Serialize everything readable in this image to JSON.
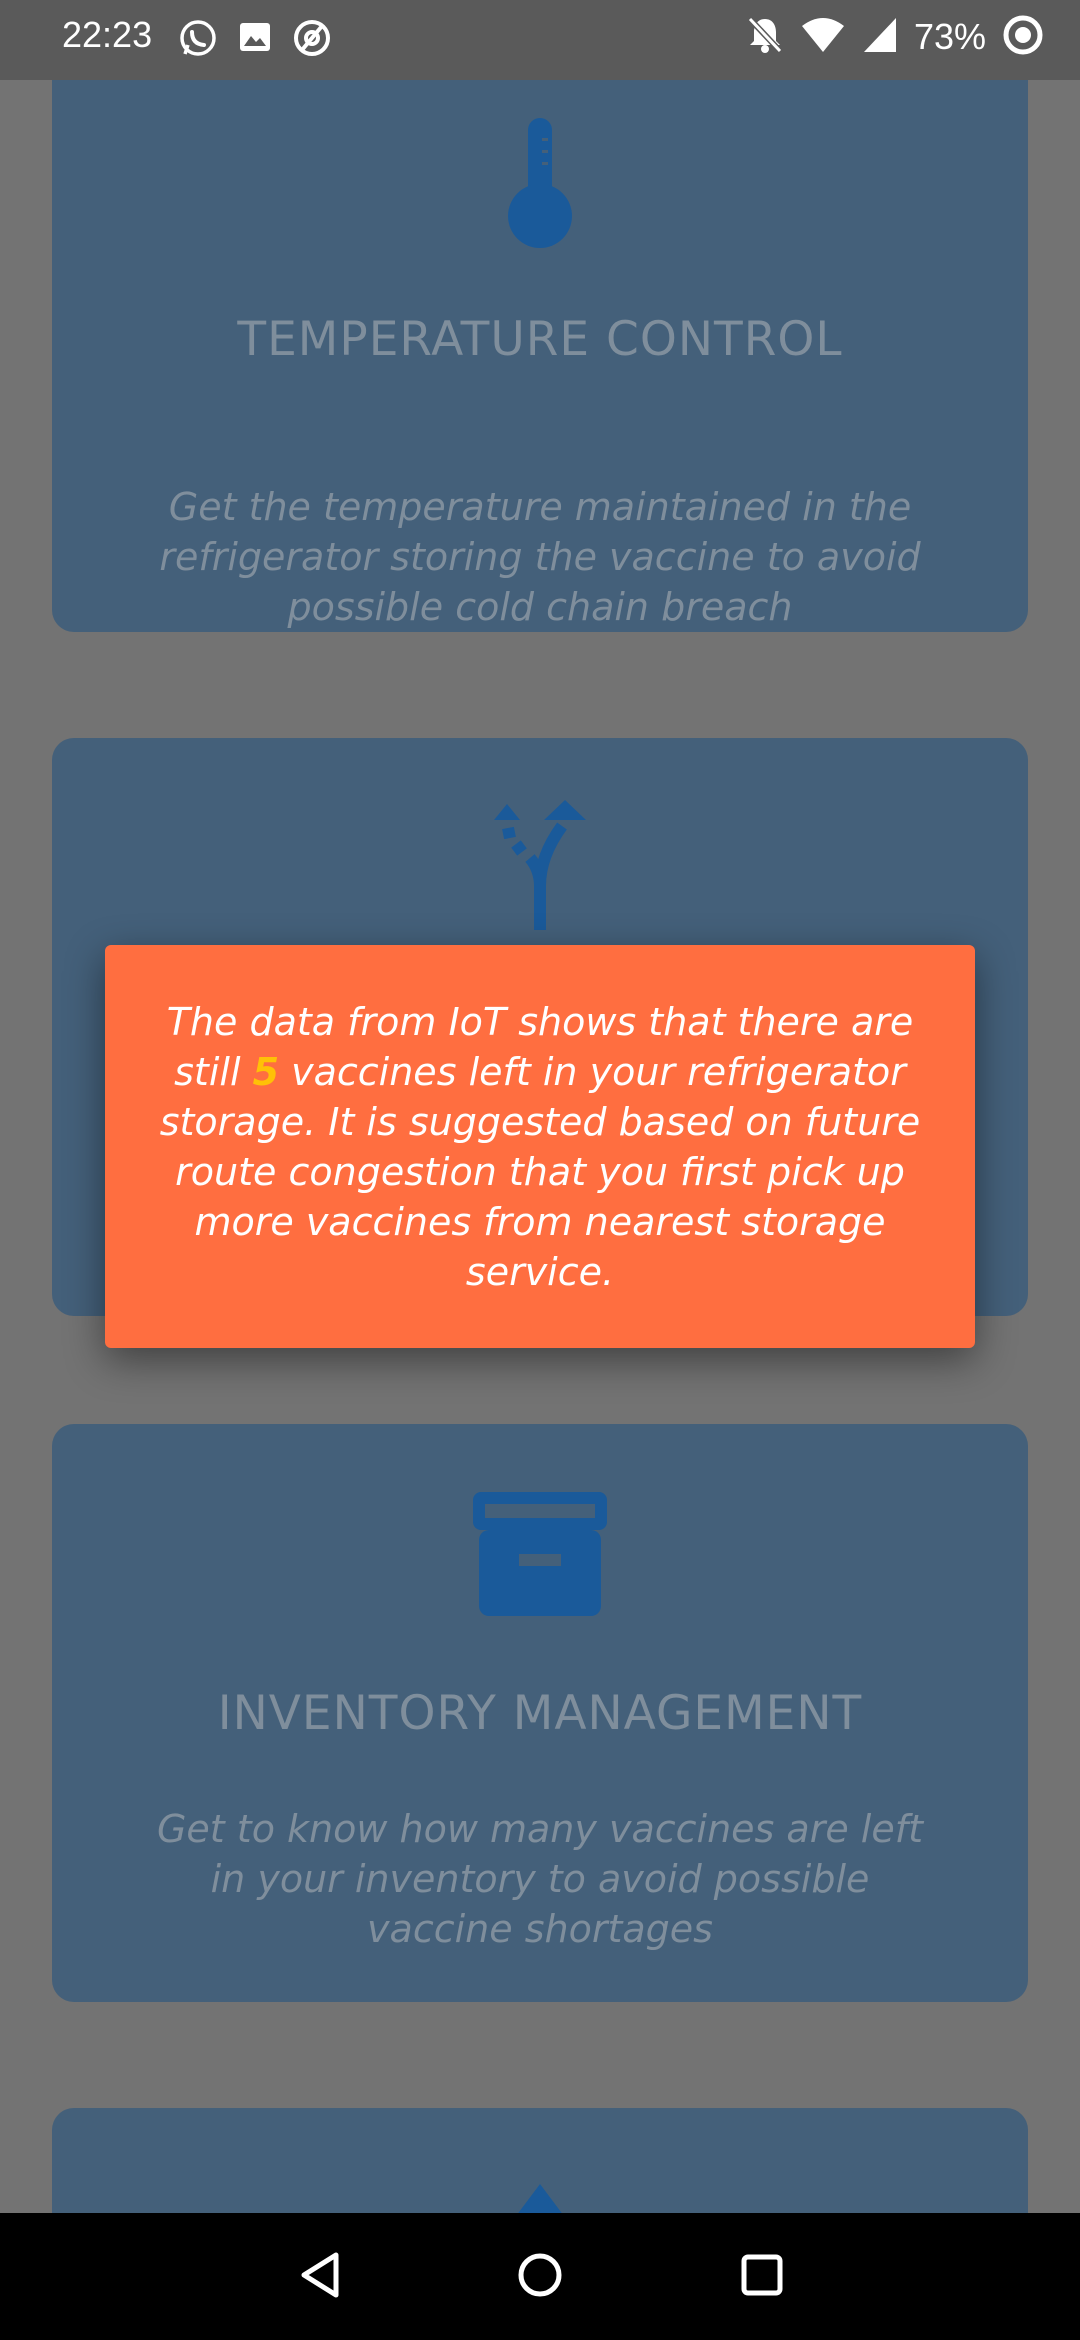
{
  "status_bar": {
    "time": "22:23",
    "battery": "73%",
    "icons_left": [
      "whatsapp-icon",
      "image-icon",
      "at-sign-icon"
    ],
    "icons_right": [
      "notifications-off-icon",
      "wifi-icon",
      "cell-signal-icon",
      "battery-ring-icon"
    ]
  },
  "cards": [
    {
      "icon": "thermometer-icon",
      "title": "TEMPERATURE CONTROL",
      "description": "Get the temperature maintained in the refrigerator storing the vaccine to avoid possible cold chain breach"
    },
    {
      "icon": "route-split-icon",
      "title": "",
      "description": ""
    },
    {
      "icon": "archive-box-icon",
      "title": "INVENTORY MANAGEMENT",
      "description": "Get to know how many vaccines are left in your inventory to avoid possible vaccine shortages"
    },
    {
      "icon": "navigation-arrow-icon",
      "title": "",
      "description": ""
    }
  ],
  "dialog": {
    "text_before": "The data from IoT shows that there are still ",
    "count": "5",
    "text_after": " vaccines left in your refrigerator storage. It is suggested based on future route congestion that you first pick up more vaccines from nearest storage service."
  },
  "colors": {
    "card_background": "#44607a",
    "card_icon": "#1a5a9a",
    "dialog_background": "#ff6e40",
    "dialog_highlight": "#ffc107",
    "overlay": "#737373"
  }
}
